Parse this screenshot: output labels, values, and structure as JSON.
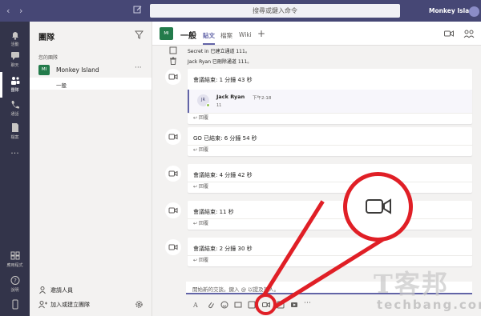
{
  "titlebar": {
    "search_placeholder": "搜尋或鍵入命令",
    "org_name": "Monkey Island"
  },
  "appbar": {
    "items": [
      {
        "label": "活動",
        "icon": "bell-icon"
      },
      {
        "label": "聊天",
        "icon": "chat-icon"
      },
      {
        "label": "團隊",
        "icon": "teams-icon"
      },
      {
        "label": "通話",
        "icon": "phone-icon"
      },
      {
        "label": "檔案",
        "icon": "files-icon"
      },
      {
        "label": "...",
        "icon": "more-icon"
      }
    ],
    "bottom_items": [
      {
        "label": "應用程式",
        "icon": "apps-icon"
      },
      {
        "label": "說明",
        "icon": "help-icon"
      }
    ]
  },
  "teams_panel": {
    "title": "團隊",
    "section_label": "您的團隊",
    "team": {
      "badge": "MI",
      "name": "Monkey Island",
      "more": "···"
    },
    "channel": {
      "name": "一般"
    },
    "invite_label": "邀請人員",
    "join_create_label": "加入或建立團隊"
  },
  "channel_header": {
    "badge": "MI",
    "title": "一般",
    "tabs": [
      "貼文",
      "檔案",
      "Wiki"
    ],
    "active_tab": "貼文",
    "add_tab": "+"
  },
  "feed": {
    "events": [
      "Secret in 已建立通道 111。",
      "Jack Ryan 已刪除通道 111。"
    ],
    "reply_label": "回覆",
    "cards": [
      {
        "title": "會議結束: 1 分鐘 43 秒",
        "nested": {
          "avatar": "JR",
          "name": "Jack Ryan",
          "time": "下午2:18",
          "text": "11"
        }
      },
      {
        "title": "GO 已結束: 6 分鐘 54 秒"
      },
      {
        "title": "會議結束: 4 分鐘 42 秒"
      },
      {
        "title": "會議結束: 11 秒"
      },
      {
        "title": "會議結束: 2 分鐘 30 秒"
      }
    ]
  },
  "compose": {
    "placeholder": "開始新的交談。鍵入 @ 以提及某人。"
  },
  "watermark": {
    "big": "T客邦",
    "small": "techbang.com"
  },
  "colors": {
    "titlebar": "#464775",
    "appbar": "#33344a",
    "accent": "#6264a7",
    "team_green": "#237b4b",
    "highlight_red": "#e01f26"
  }
}
